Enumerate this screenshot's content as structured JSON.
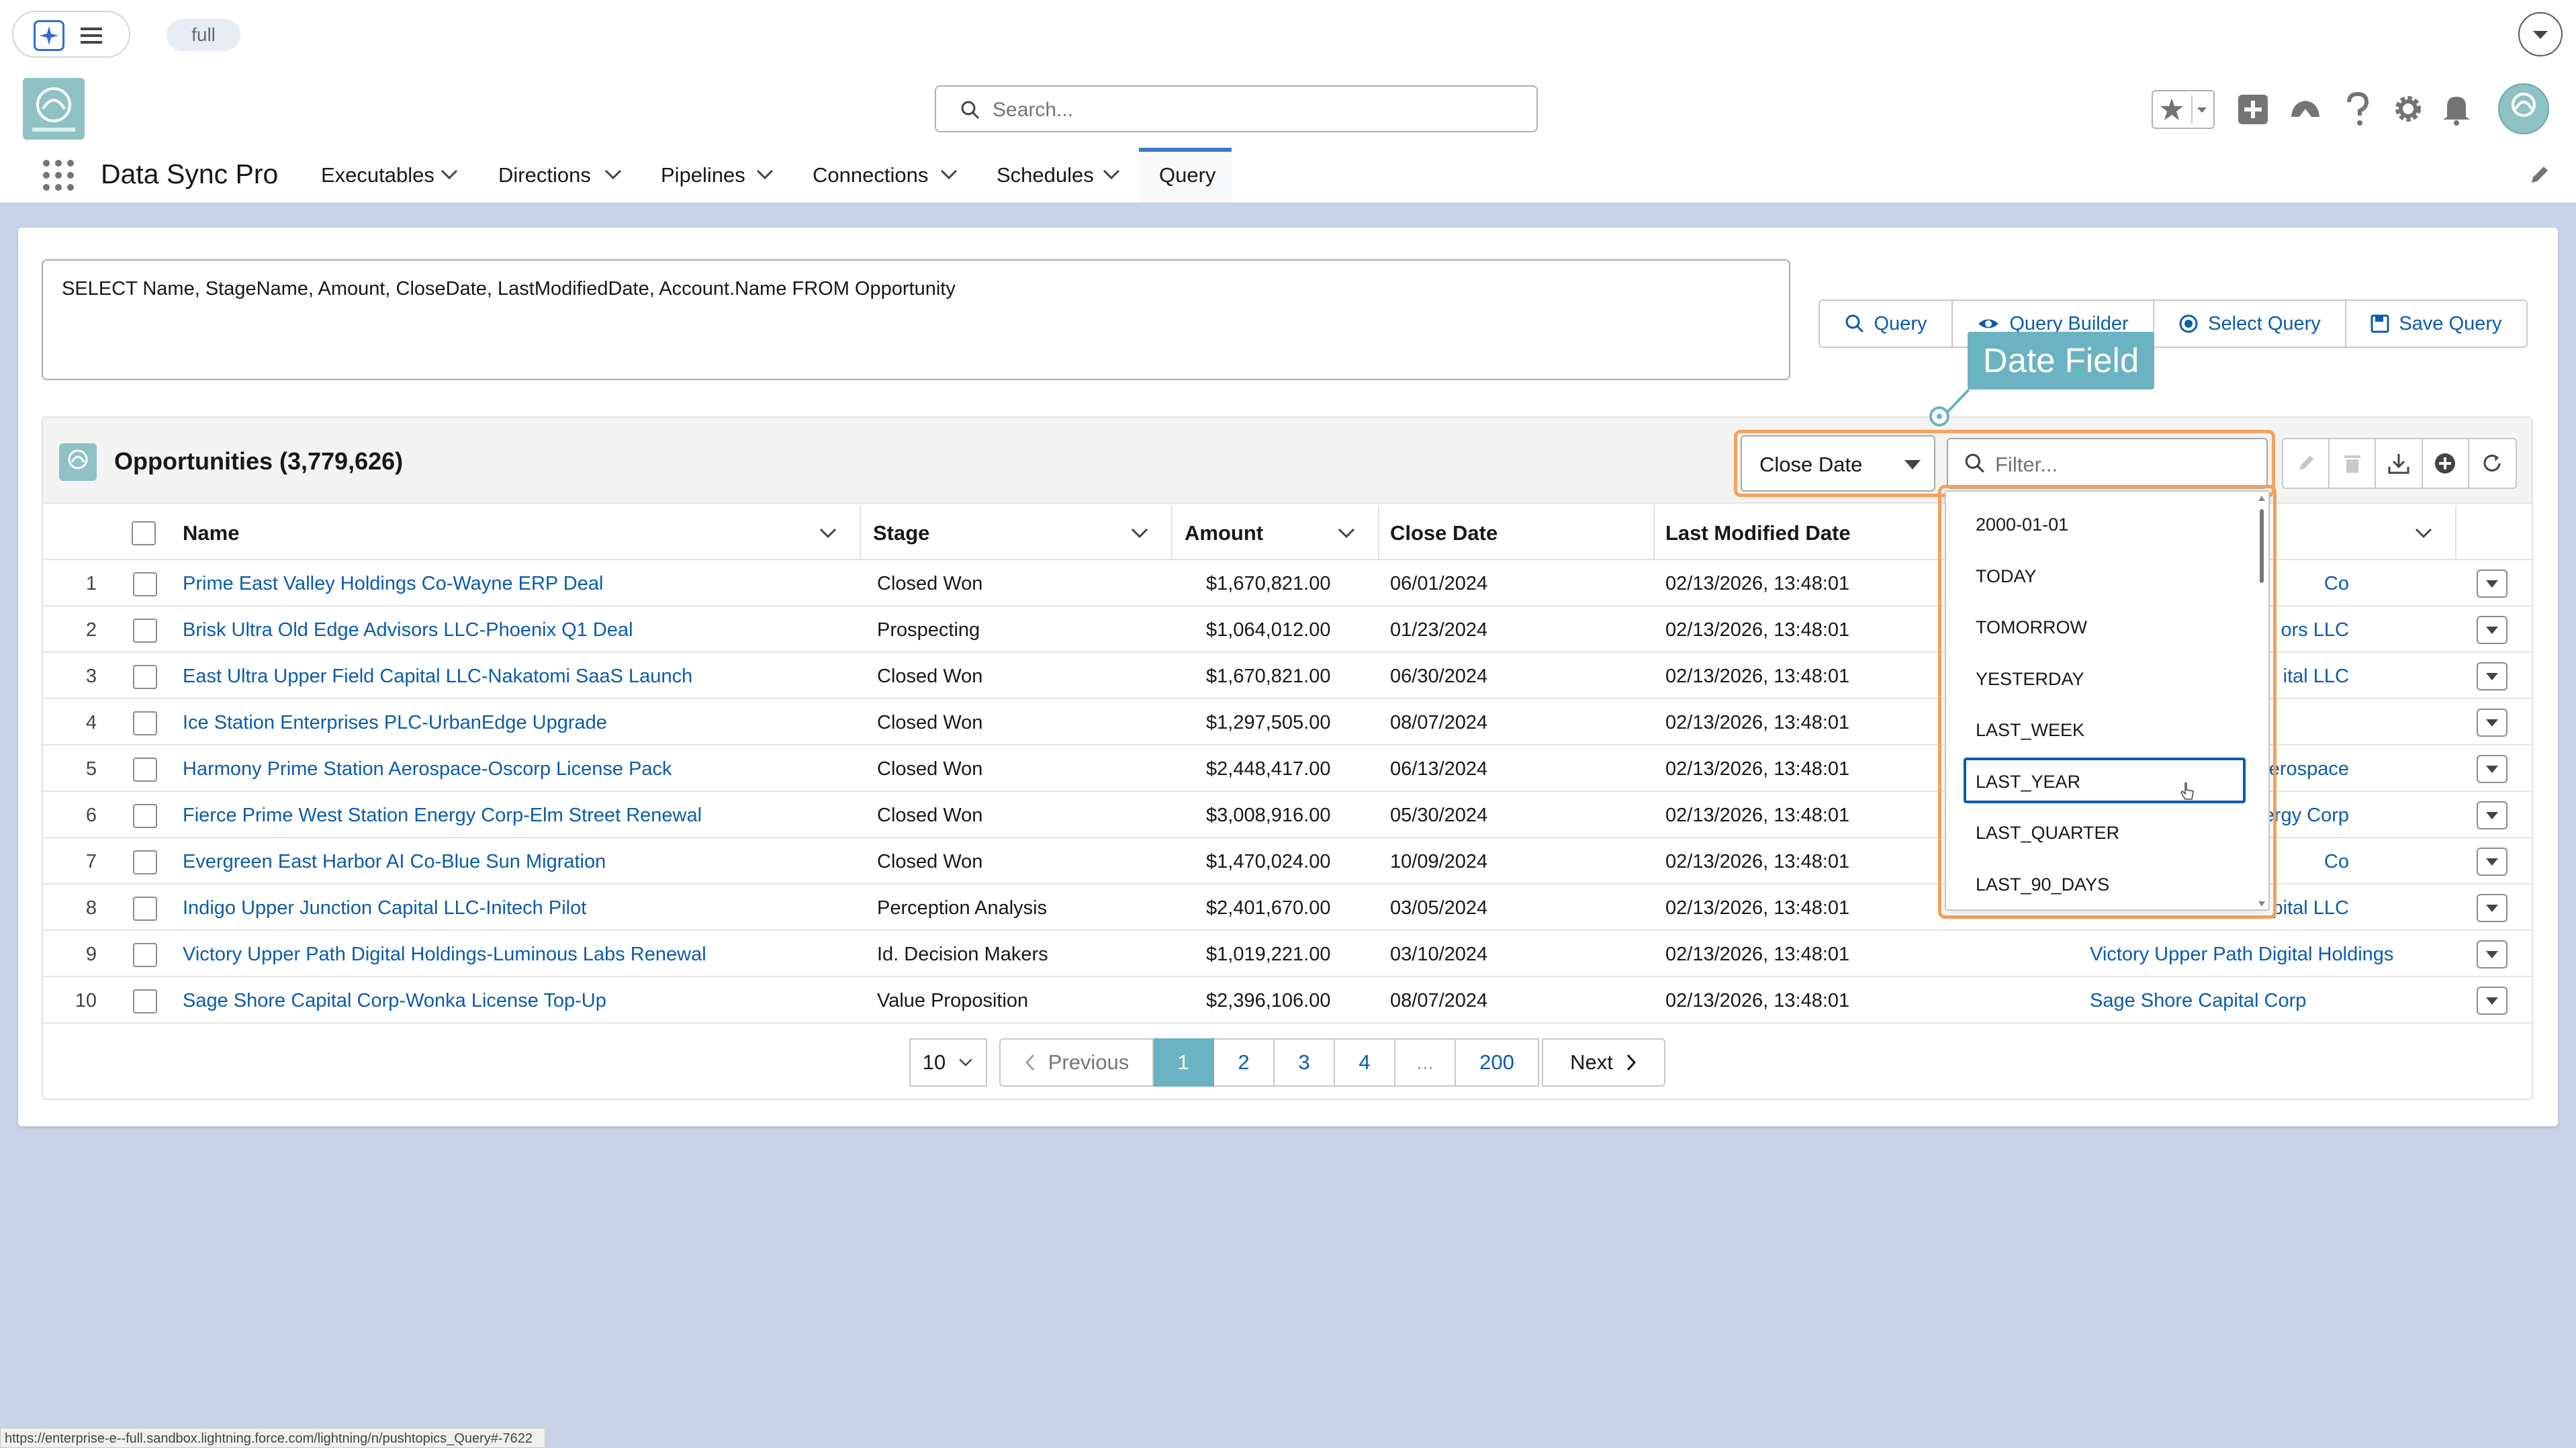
{
  "browser": {
    "env_chip": "full"
  },
  "header": {
    "search_placeholder": "Search..."
  },
  "nav": {
    "app_title": "Data Sync Pro",
    "tabs": [
      {
        "label": "Executables",
        "dropdown": true
      },
      {
        "label": "Directions",
        "dropdown": true
      },
      {
        "label": "Pipelines",
        "dropdown": true
      },
      {
        "label": "Connections",
        "dropdown": true
      },
      {
        "label": "Schedules",
        "dropdown": true
      },
      {
        "label": "Query",
        "dropdown": false,
        "active": true
      }
    ]
  },
  "query": {
    "text": "SELECT Name, StageName, Amount, CloseDate, LastModifiedDate, Account.Name FROM Opportunity",
    "buttons": {
      "query": "Query",
      "builder": "Query Builder",
      "select": "Select Query",
      "save": "Save Query"
    }
  },
  "tooltip": {
    "text": "Date Field"
  },
  "results": {
    "title": "Opportunities (3,779,626)",
    "date_field": "Close Date",
    "filter_placeholder": "Filter...",
    "columns": {
      "name": "Name",
      "stage": "Stage",
      "amount": "Amount",
      "close_date": "Close Date",
      "last_modified": "Last Modified Date"
    },
    "rows": [
      {
        "num": "1",
        "name": "Prime East Valley Holdings Co-Wayne ERP Deal",
        "stage": "Closed Won",
        "amount": "$1,670,821.00",
        "close_date": "06/01/2024",
        "modified": "02/13/2026, 13:48:01",
        "account": "Co"
      },
      {
        "num": "2",
        "name": "Brisk Ultra Old Edge Advisors LLC-Phoenix Q1 Deal",
        "stage": "Prospecting",
        "amount": "$1,064,012.00",
        "close_date": "01/23/2024",
        "modified": "02/13/2026, 13:48:01",
        "account": "ors LLC"
      },
      {
        "num": "3",
        "name": "East Ultra Upper Field Capital LLC-Nakatomi SaaS Launch",
        "stage": "Closed Won",
        "amount": "$1,670,821.00",
        "close_date": "06/30/2024",
        "modified": "02/13/2026, 13:48:01",
        "account": "ital LLC"
      },
      {
        "num": "4",
        "name": "Ice Station Enterprises PLC-UrbanEdge Upgrade",
        "stage": "Closed Won",
        "amount": "$1,297,505.00",
        "close_date": "08/07/2024",
        "modified": "02/13/2026, 13:48:01",
        "account": ""
      },
      {
        "num": "5",
        "name": "Harmony Prime Station Aerospace-Oscorp License Pack",
        "stage": "Closed Won",
        "amount": "$2,448,417.00",
        "close_date": "06/13/2024",
        "modified": "02/13/2026, 13:48:01",
        "account": "erospace"
      },
      {
        "num": "6",
        "name": "Fierce Prime West Station Energy Corp-Elm Street Renewal",
        "stage": "Closed Won",
        "amount": "$3,008,916.00",
        "close_date": "05/30/2024",
        "modified": "02/13/2026, 13:48:01",
        "account": "Energy Corp"
      },
      {
        "num": "7",
        "name": "Evergreen East Harbor AI Co-Blue Sun Migration",
        "stage": "Closed Won",
        "amount": "$1,470,024.00",
        "close_date": "10/09/2024",
        "modified": "02/13/2026, 13:48:01",
        "account": "Co"
      },
      {
        "num": "8",
        "name": "Indigo Upper Junction Capital LLC-Initech Pilot",
        "stage": "Perception Analysis",
        "amount": "$2,401,670.00",
        "close_date": "03/05/2024",
        "modified": "02/13/2026, 13:48:01",
        "account": "pital LLC"
      },
      {
        "num": "9",
        "name": "Victory Upper Path Digital Holdings-Luminous Labs Renewal",
        "stage": "Id. Decision Makers",
        "amount": "$1,019,221.00",
        "close_date": "03/10/2024",
        "modified": "02/13/2026, 13:48:01",
        "account": "Victory Upper Path Digital Holdings"
      },
      {
        "num": "10",
        "name": "Sage Shore Capital Corp-Wonka License Top-Up",
        "stage": "Value Proposition",
        "amount": "$2,396,106.00",
        "close_date": "08/07/2024",
        "modified": "02/13/2026, 13:48:01",
        "account": "Sage Shore Capital Corp"
      }
    ]
  },
  "date_options": [
    "2000-01-01",
    "TODAY",
    "TOMORROW",
    "YESTERDAY",
    "LAST_WEEK",
    "LAST_YEAR",
    "LAST_QUARTER",
    "LAST_90_DAYS"
  ],
  "selected_option": "LAST_YEAR",
  "pagination": {
    "page_size": "10",
    "previous": "Previous",
    "pages": [
      "1",
      "2",
      "3",
      "4",
      "...",
      "200"
    ],
    "current": "1",
    "next": "Next"
  },
  "status_url": "https://enterprise-e--full.sandbox.lightning.force.com/lightning/n/pushtopics_Query#-7622",
  "colors": {
    "brand_blue": "#0b5cab",
    "highlight_orange": "#f3a25d",
    "tooltip_teal": "#6bb3c2",
    "page_bg": "#c8d4e6"
  }
}
